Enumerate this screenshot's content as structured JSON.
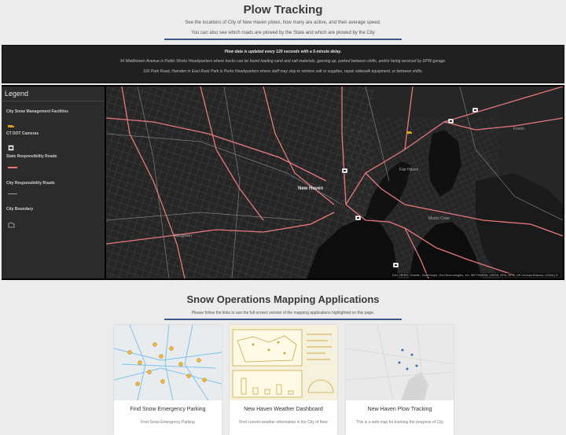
{
  "header": {
    "title": "Plow Tracking",
    "subtitle_1": "See the locations of City of New Haven plows, how many are active, and their average speed.",
    "subtitle_2": "You can also see which roads are plowed by the State and which are plowed by the City"
  },
  "notice": {
    "line_1": "Plow data is updated every 120 seconds with a 5-minute delay.",
    "line_2": "34 Middletown Avenue is Public Works Headquarters where trucks can be found loading sand and salt materials, gassing up, parked between shifts, and/or being serviced by DPW garage.",
    "line_3": "160 Park Road, Hamden in East Rock Park is Parks Headquarters where staff may stop to retrieve salt or supplies, repair sidewalk equipment, or between shifts."
  },
  "legend": {
    "heading": "Legend",
    "items": [
      {
        "label": "City Snow Management Facilities",
        "icon": "plow-truck-icon"
      },
      {
        "label": "CT DOT Cameras",
        "icon": "camera-icon"
      },
      {
        "label": "State Responsibility Roads",
        "color": "#e8787c"
      },
      {
        "label": "City Responsibility Roads",
        "color": "#8a8a8a"
      },
      {
        "label": "City Boundary",
        "icon": "polygon-outline-icon"
      }
    ]
  },
  "map": {
    "places": {
      "new_haven": "New Haven",
      "east_haven": "East Haven",
      "morris_cove": "Morris Cove",
      "fair_haven": "Fair Haven",
      "allingtown": "Allingtown",
      "foxon": "Foxon"
    },
    "attribution": "Esri, HERE, Garmin, SafeGraph, GeoTechnologies, Inc, METI/NASA, USGS, EPA, NPS, US Census Bureau, USDA | E",
    "colors": {
      "state_road": "#e8787c",
      "city_road": "#7d7d7d",
      "water": "#0d0d0d",
      "land": "#262626"
    }
  },
  "apps_section": {
    "title": "Snow Operations Mapping Applications",
    "subtitle": "Please follow the links to see the full-screen version of the mapping applications highlighted on this page.",
    "cards": [
      {
        "title": "Find Snow Emergency Parking",
        "desc": "Find Snow Emergency Parking"
      },
      {
        "title": "New Haven Weather Dashboard",
        "desc": "Find current weather information in the City of New"
      },
      {
        "title": "New Haven Plow Tracking",
        "desc": "This is a web map for tracking the progress of City"
      }
    ]
  }
}
